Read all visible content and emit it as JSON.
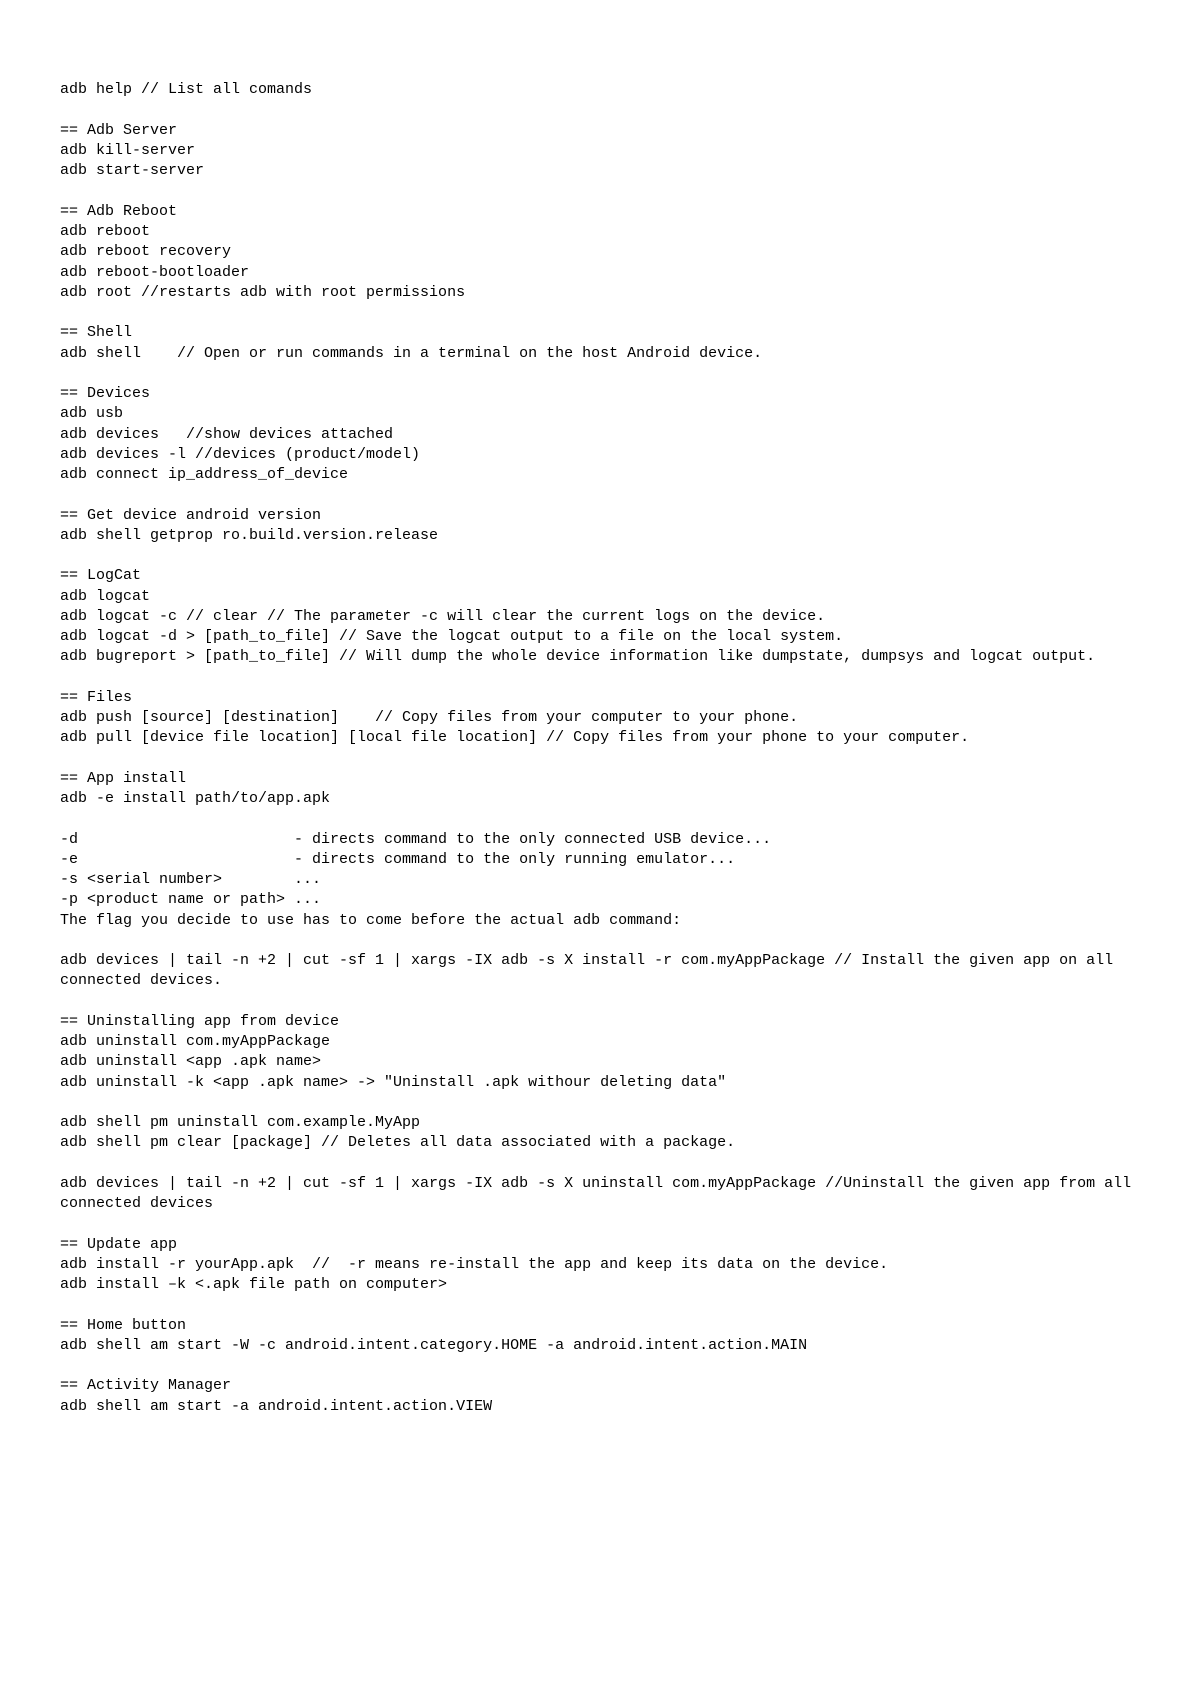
{
  "content": "adb help // List all comands\n\n== Adb Server\nadb kill-server\nadb start-server \n\n== Adb Reboot\nadb reboot\nadb reboot recovery \nadb reboot-bootloader\nadb root //restarts adb with root permissions\n\n== Shell\nadb shell    // Open or run commands in a terminal on the host Android device.\n\n== Devices\nadb usb\nadb devices   //show devices attached\nadb devices -l //devices (product/model)\nadb connect ip_address_of_device\n\n== Get device android version\nadb shell getprop ro.build.version.release \n\n== LogCat\nadb logcat\nadb logcat -c // clear // The parameter -c will clear the current logs on the device.\nadb logcat -d > [path_to_file] // Save the logcat output to a file on the local system.\nadb bugreport > [path_to_file] // Will dump the whole device information like dumpstate, dumpsys and logcat output.\n\n== Files\nadb push [source] [destination]    // Copy files from your computer to your phone.\nadb pull [device file location] [local file location] // Copy files from your phone to your computer.\n\n== App install\nadb -e install path/to/app.apk\n\n-d                        - directs command to the only connected USB device...\n-e                        - directs command to the only running emulator...\n-s <serial number>        ...\n-p <product name or path> ...\nThe flag you decide to use has to come before the actual adb command:\n\nadb devices | tail -n +2 | cut -sf 1 | xargs -IX adb -s X install -r com.myAppPackage // Install the given app on all connected devices.\n\n== Uninstalling app from device\nadb uninstall com.myAppPackage\nadb uninstall <app .apk name>\nadb uninstall -k <app .apk name> -> \"Uninstall .apk withour deleting data\"\n\nadb shell pm uninstall com.example.MyApp\nadb shell pm clear [package] // Deletes all data associated with a package.\n\nadb devices | tail -n +2 | cut -sf 1 | xargs -IX adb -s X uninstall com.myAppPackage //Uninstall the given app from all connected devices\n\n== Update app\nadb install -r yourApp.apk  //  -r means re-install the app and keep its data on the device.\nadb install –k <.apk file path on computer> \n\n== Home button\nadb shell am start -W -c android.intent.category.HOME -a android.intent.action.MAIN\n\n== Activity Manager\nadb shell am start -a android.intent.action.VIEW"
}
